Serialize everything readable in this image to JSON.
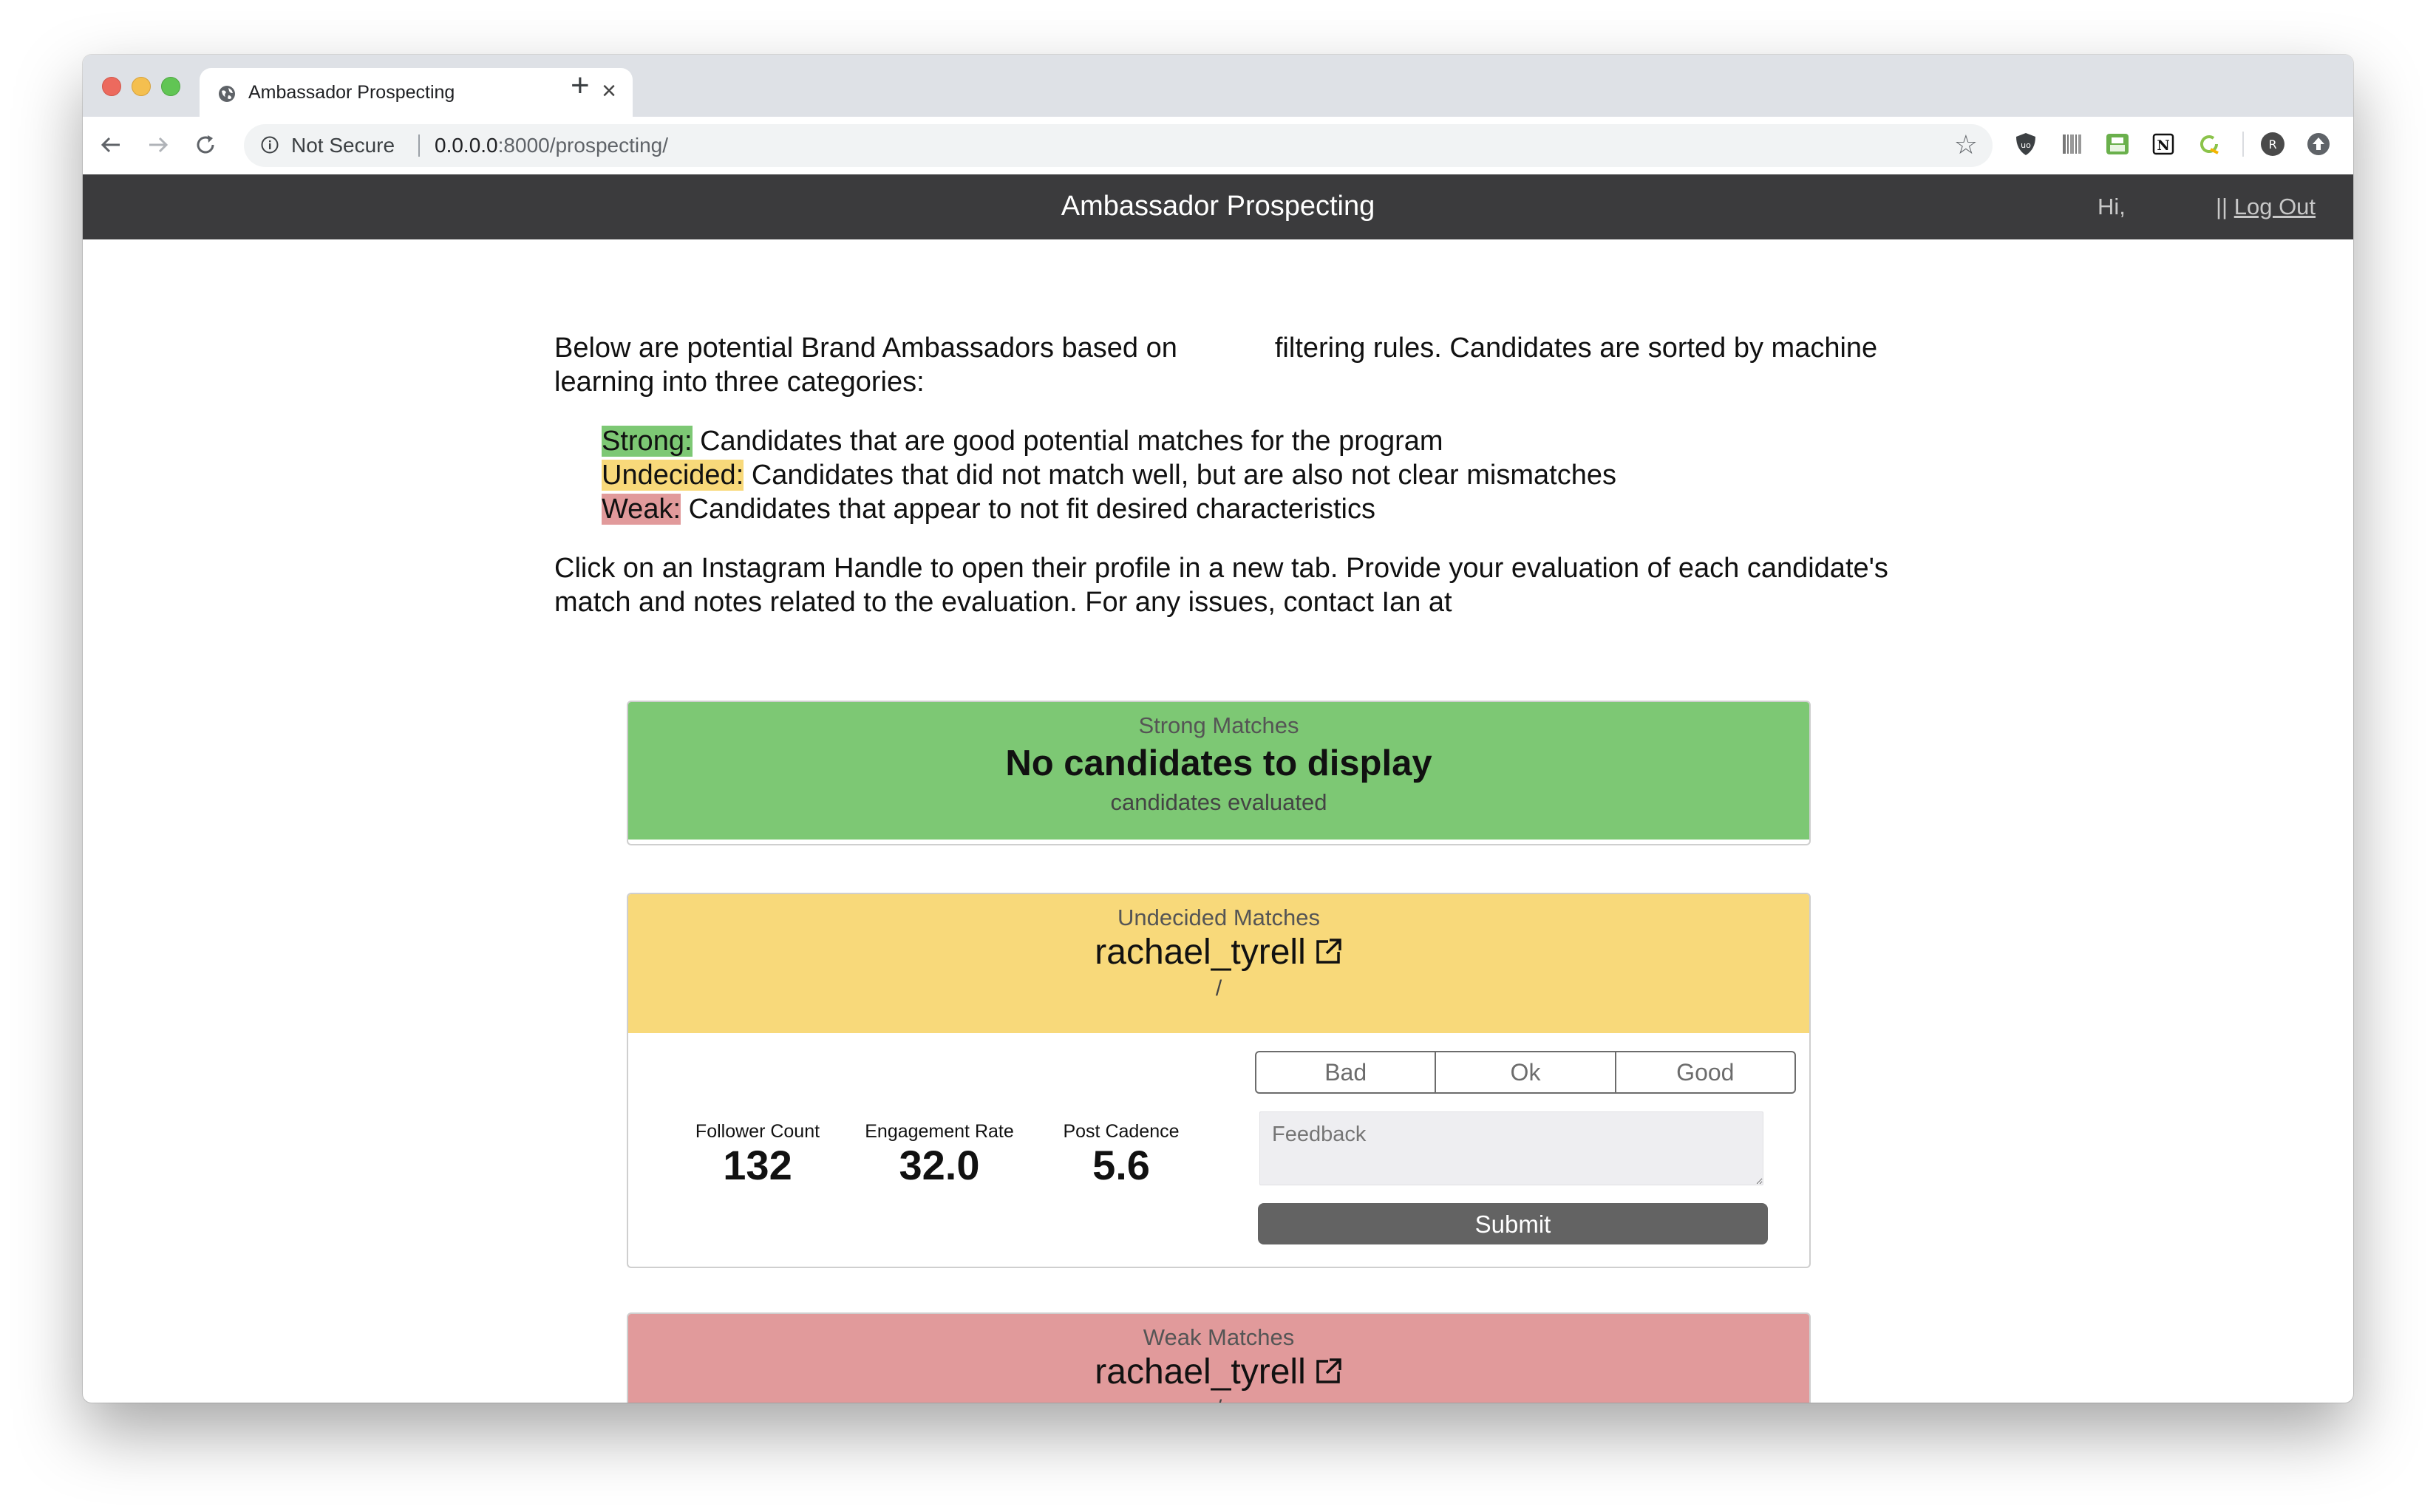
{
  "browser": {
    "tab_title": "Ambassador Prospecting",
    "tab_close": "×",
    "new_tab": "+",
    "not_secure": "Not Secure",
    "url_host": "0.0.0.0",
    "url_rest": ":8000/prospecting/",
    "icons": [
      "back-arrow-icon",
      "forward-arrow-icon",
      "reload-icon",
      "info-icon",
      "star-icon"
    ],
    "extensions": [
      "ublock-icon",
      "barcode-icon",
      "printer-icon",
      "notion-icon",
      "refresh-green-icon",
      "profile-avatar-icon",
      "upload-icon"
    ],
    "profile_initial": "R"
  },
  "header": {
    "title": "Ambassador Prospecting",
    "greeting": "Hi,",
    "sep": "||",
    "logout": "Log Out"
  },
  "intro": {
    "part1": "Below are potential Brand Ambassadors based on",
    "part2": "filtering rules. Candidates are sorted by machine learning into three categories:",
    "categories": [
      {
        "label": "Strong:",
        "desc": "Candidates that are good potential matches for the program"
      },
      {
        "label": "Undecided:",
        "desc": "Candidates that did not match well, but are also not clear mismatches"
      },
      {
        "label": "Weak:",
        "desc": "Candidates that appear to not fit  desired characteristics"
      }
    ],
    "click_text": "Click on an Instagram Handle to open their profile in a new tab. Provide your evaluation of each candidate's match and notes related to the evaluation. For any issues, contact Ian at"
  },
  "strong": {
    "label": "Strong Matches",
    "empty": "No candidates to display",
    "evaluated": "candidates evaluated",
    "color": "#7dc874"
  },
  "undecided": {
    "label": "Undecided Matches",
    "handle": "rachael_tyrell",
    "slash": "/",
    "color": "#f8d97a",
    "stats": [
      {
        "label": "Follower Count",
        "value": "132"
      },
      {
        "label": "Engagement Rate",
        "value": "32.0"
      },
      {
        "label": "Post Cadence",
        "value": "5.6"
      }
    ],
    "rating_options": [
      "Bad",
      "Ok",
      "Good"
    ],
    "feedback_placeholder": "Feedback",
    "submit": "Submit"
  },
  "weak": {
    "label": "Weak Matches",
    "handle": "rachael_tyrell",
    "slash": "/",
    "color": "#e19a9b"
  }
}
